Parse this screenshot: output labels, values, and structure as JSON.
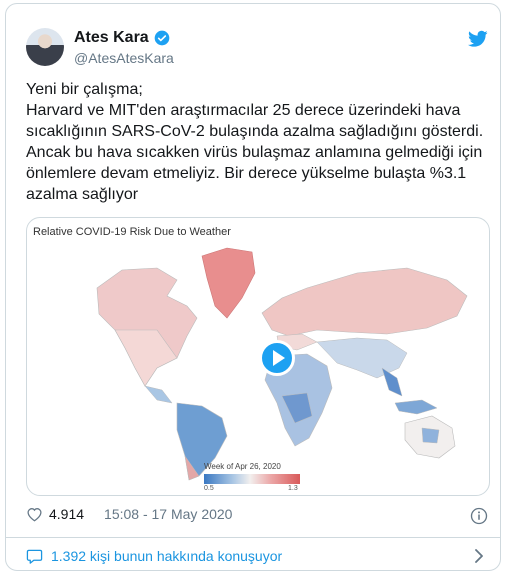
{
  "author": {
    "display_name": "Ates Kara",
    "handle": "@AtesAtesKara"
  },
  "tweet": {
    "text": "Yeni bir çalışma;\nHarvard ve MIT'den araştırmacılar 25 derece üzerindeki hava sıcaklığının SARS-CoV-2 bulaşında azalma sağladığını gösterdi. Ancak bu hava sıcakken virüs bulaşmaz anlamına gelmediği için önlemlere devam etmeliyiz. Bir derece yükselme bulaşta %3.1 azalma sağlıyor"
  },
  "media": {
    "title": "Relative COVID-19 Risk Due to Weather",
    "week_label": "Week of Apr 26, 2020",
    "legend_min": "0.5",
    "legend_max": "1.3",
    "colors": {
      "low": "#3a78c2",
      "neutral": "#f2efee",
      "high": "#d95a5a"
    }
  },
  "footer": {
    "likes": "4.914",
    "timestamp": "15:08 - 17 May 2020",
    "conversation": "1.392 kişi bunun hakkında konuşuyor"
  },
  "icons": {
    "verified": "verified-badge-icon",
    "bird": "twitter-bird-icon",
    "heart": "heart-icon",
    "info": "info-icon",
    "bubble": "speech-bubble-icon",
    "chevron": "chevron-right-icon",
    "play": "play-icon"
  },
  "accent": "#1da1f2"
}
